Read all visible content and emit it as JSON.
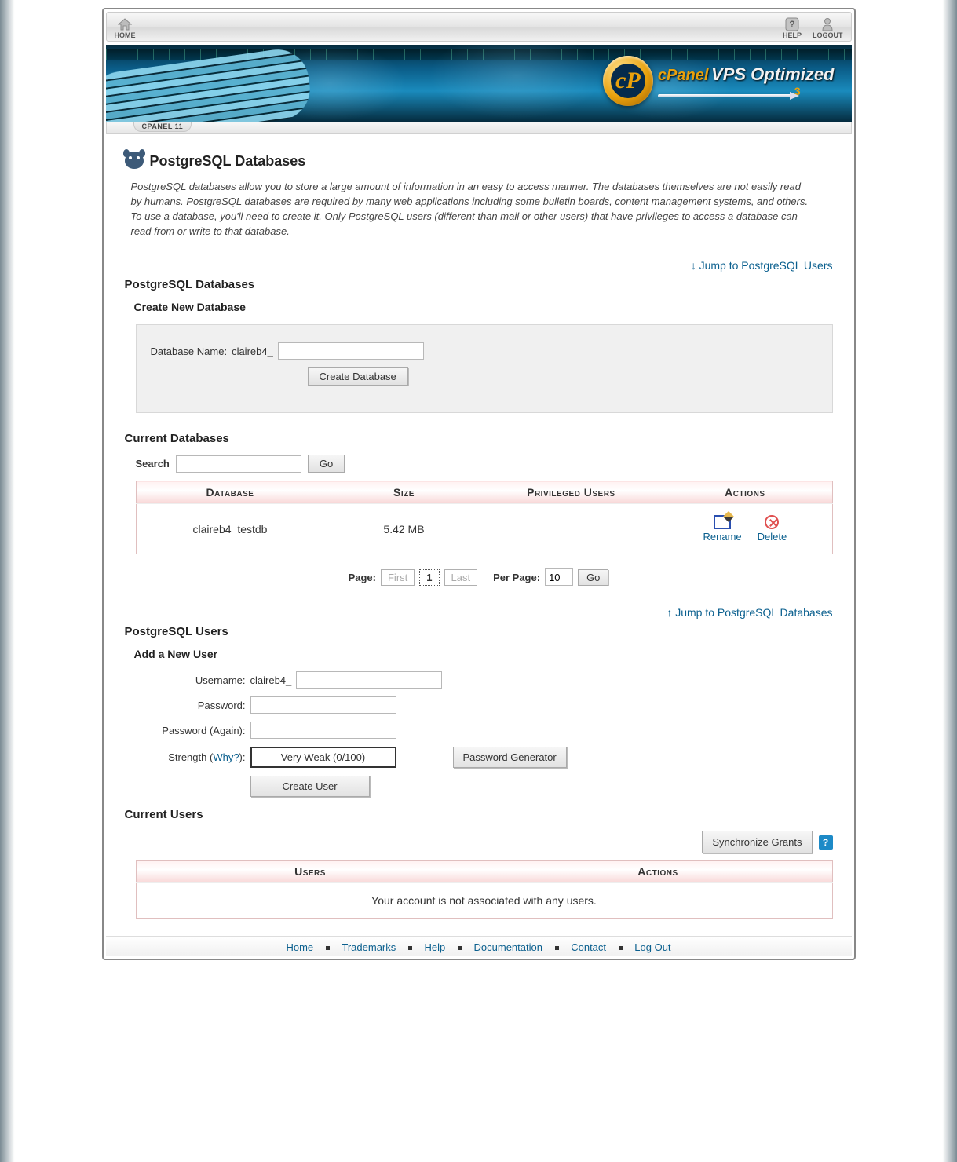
{
  "topbar": {
    "home": "HOME",
    "help": "HELP",
    "logout": "LOGOUT"
  },
  "header": {
    "cpanel": "cPanel",
    "vps": "VPS Optimized",
    "subnum": "3",
    "tab": "CPANEL 11"
  },
  "page": {
    "title": "PostgreSQL Databases",
    "intro": "PostgreSQL databases allow you to store a large amount of information in an easy to access manner. The databases themselves are not easily read by humans. PostgreSQL databases are required by many web applications including some bulletin boards, content management systems, and others. To use a database, you'll need to create it. Only PostgreSQL users (different than mail or other users) that have privileges to access a database can read from or write to that database."
  },
  "links": {
    "jump_users": "Jump to PostgreSQL Users",
    "jump_db": "Jump to PostgreSQL Databases"
  },
  "sections": {
    "pgdb": "PostgreSQL Databases",
    "create_db": "Create New Database",
    "current_db": "Current Databases",
    "pgusers": "PostgreSQL Users",
    "add_user": "Add a New User",
    "current_users": "Current Users"
  },
  "createdb": {
    "label": "Database Name:",
    "prefix": "claireb4_",
    "value": "",
    "button": "Create Database"
  },
  "search": {
    "label": "Search",
    "value": "",
    "button": "Go"
  },
  "db_table": {
    "headers": {
      "db": "Database",
      "size": "Size",
      "priv": "Privileged Users",
      "actions": "Actions"
    },
    "rows": [
      {
        "name": "claireb4_testdb",
        "size": "5.42 MB",
        "priv": ""
      }
    ],
    "actions": {
      "rename": "Rename",
      "delete": "Delete"
    }
  },
  "pagination": {
    "page_label": "Page:",
    "first": "First",
    "current": "1",
    "last": "Last",
    "perpage_label": "Per Page:",
    "perpage_value": "10",
    "go": "Go"
  },
  "userform": {
    "username_label": "Username:",
    "username_prefix": "claireb4_",
    "username_value": "",
    "password_label": "Password:",
    "password2_label": "Password (Again):",
    "strength_label_a": "Strength (",
    "strength_why": "Why?",
    "strength_label_b": "):",
    "strength_value": "Very Weak (0/100)",
    "pwgen": "Password Generator",
    "create": "Create User"
  },
  "sync": {
    "button": "Synchronize Grants"
  },
  "users_table": {
    "headers": {
      "users": "Users",
      "actions": "Actions"
    },
    "empty": "Your account is not associated with any users."
  },
  "footer": {
    "home": "Home",
    "trademarks": "Trademarks",
    "help": "Help",
    "documentation": "Documentation",
    "contact": "Contact",
    "logout": "Log Out"
  }
}
